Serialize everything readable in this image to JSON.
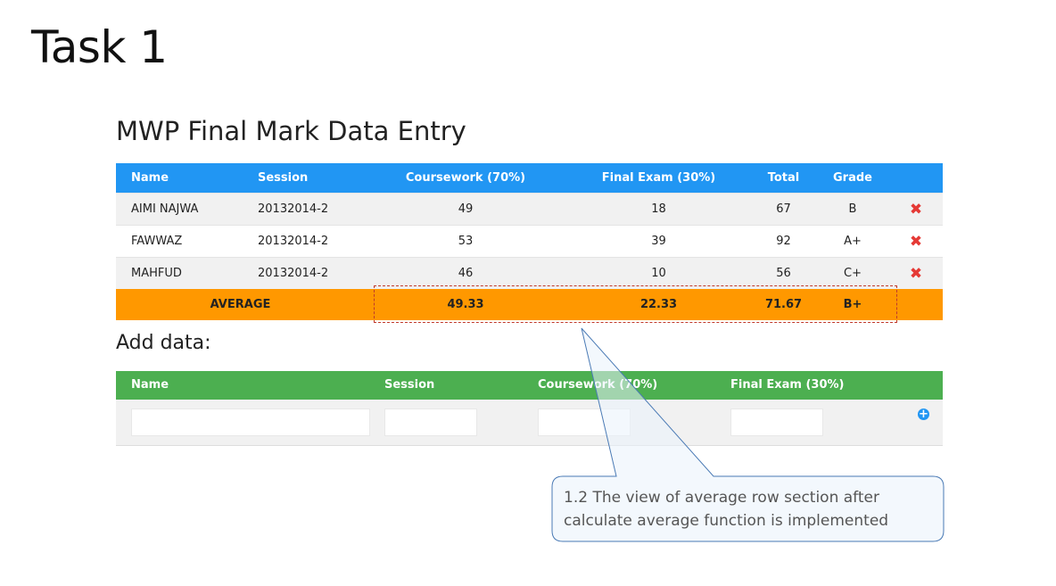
{
  "slide": {
    "title": "Task 1"
  },
  "form": {
    "title": "MWP Final Mark Data Entry"
  },
  "table": {
    "columns": [
      "Name",
      "Session",
      "Coursework (70%)",
      "Final Exam (30%)",
      "Total",
      "Grade"
    ],
    "rows": [
      {
        "name": "AIMI NAJWA",
        "session": "20132014-2",
        "coursework": "49",
        "final": "18",
        "total": "67",
        "grade": "B"
      },
      {
        "name": "FAWWAZ",
        "session": "20132014-2",
        "coursework": "53",
        "final": "39",
        "total": "92",
        "grade": "A+"
      },
      {
        "name": "MAHFUD",
        "session": "20132014-2",
        "coursework": "46",
        "final": "10",
        "total": "56",
        "grade": "C+"
      }
    ],
    "delete_icon": "✖",
    "average": {
      "label": "AVERAGE",
      "coursework": "49.33",
      "final": "22.33",
      "total": "71.67",
      "grade": "B+"
    }
  },
  "add": {
    "title": "Add data:",
    "columns": [
      "Name",
      "Session",
      "Coursework (70%)",
      "Final Exam (30%)"
    ],
    "inputs": {
      "name": "",
      "session": "",
      "coursework": "",
      "final": ""
    },
    "add_icon": "+"
  },
  "callout": {
    "line1": "1.2 The view of average row section after",
    "line2": "calculate average function is implemented"
  },
  "colors": {
    "header_blue": "#2196f3",
    "average_orange": "#ff9800",
    "add_header_green": "#4caf50",
    "delete_red": "#e53935",
    "callout_fill": "#eaf2fb",
    "callout_border": "#4a7ab5"
  }
}
